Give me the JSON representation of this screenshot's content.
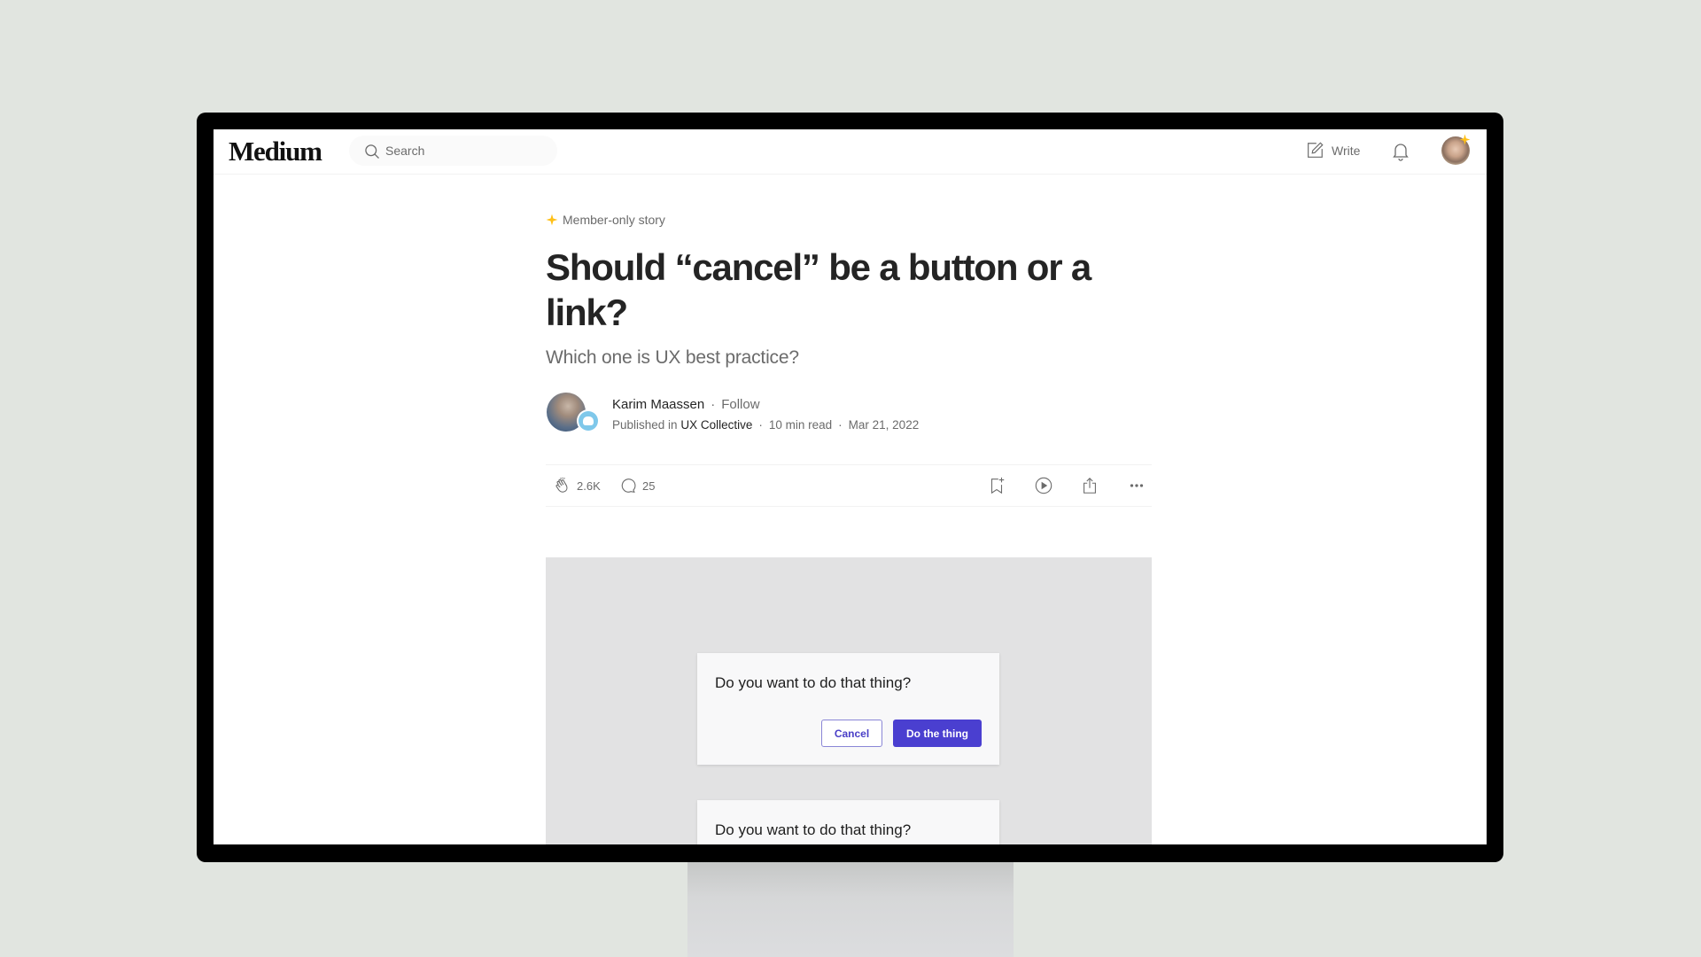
{
  "header": {
    "logo": "Medium",
    "search_placeholder": "Search",
    "write_label": "Write"
  },
  "article": {
    "badge": "Member-only story",
    "title": "Should “cancel” be a button or a link?",
    "subtitle": "Which one is UX best practice?",
    "author": {
      "name": "Karim Maassen",
      "follow_label": "Follow",
      "published_prefix": "Published in",
      "publication": "UX Collective",
      "read_time": "10 min read",
      "date": "Mar 21, 2022"
    },
    "actions": {
      "claps": "2.6K",
      "comments": "25"
    },
    "figure": {
      "dialogs": [
        {
          "question": "Do you want to do that thing?",
          "cancel_label": "Cancel",
          "confirm_label": "Do the thing"
        },
        {
          "question": "Do you want to do that thing?"
        }
      ]
    }
  },
  "colors": {
    "member_star": "#ffc017",
    "primary_button": "#4a3fd0",
    "cancel_border": "#8a86d6",
    "background": "#e1e5e0"
  },
  "separator": "·"
}
